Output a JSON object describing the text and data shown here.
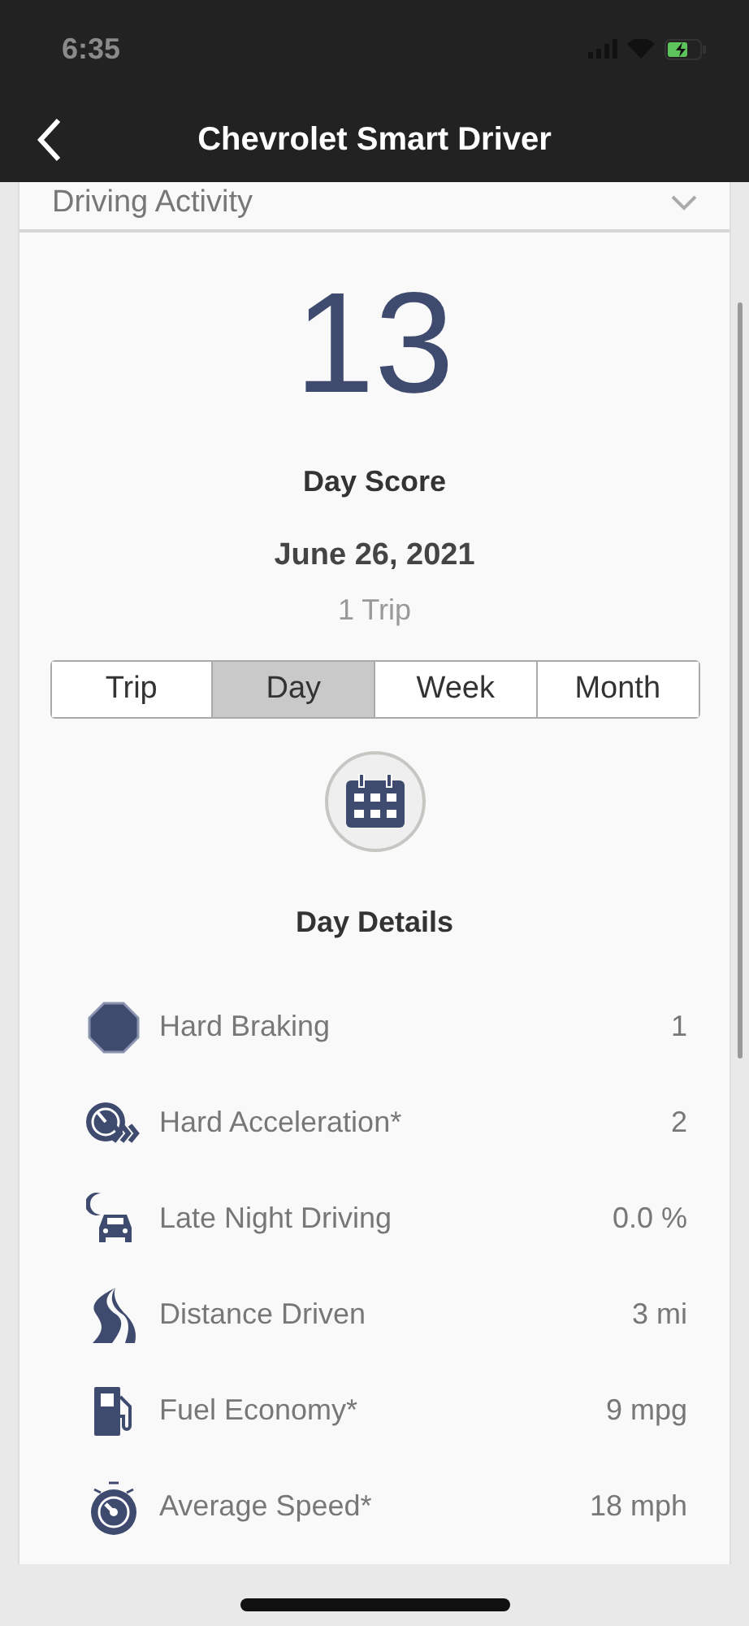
{
  "status_bar": {
    "time": "6:35"
  },
  "nav": {
    "title": "Chevrolet Smart Driver"
  },
  "section": {
    "title": "Driving Activity",
    "expanded": false
  },
  "score": {
    "value": "13",
    "label": "Day Score",
    "date": "June 26, 2021",
    "trips": "1 Trip"
  },
  "segments": [
    {
      "label": "Trip",
      "selected": false
    },
    {
      "label": "Day",
      "selected": true
    },
    {
      "label": "Week",
      "selected": false
    },
    {
      "label": "Month",
      "selected": false
    }
  ],
  "details": {
    "title": "Day Details",
    "rows": [
      {
        "kind": "braking",
        "label": "Hard Braking",
        "value": "1"
      },
      {
        "kind": "acceleration",
        "label": "Hard Acceleration*",
        "value": "2"
      },
      {
        "kind": "night",
        "label": "Late Night Driving",
        "value": "0.0 %"
      },
      {
        "kind": "distance",
        "label": "Distance Driven",
        "value": "3 mi"
      },
      {
        "kind": "fuel",
        "label": "Fuel Economy*",
        "value": "9 mpg"
      },
      {
        "kind": "speed",
        "label": "Average Speed*",
        "value": "18 mph"
      }
    ]
  }
}
